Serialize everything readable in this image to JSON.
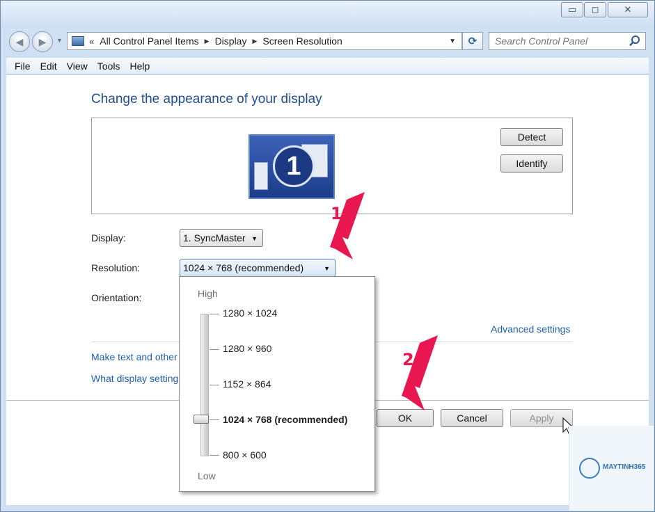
{
  "window": {
    "minimize_glyph": "▭",
    "maximize_glyph": "◻",
    "close_glyph": "✕"
  },
  "nav": {
    "crumb_overflow": "«",
    "breadcrumbs": [
      "All Control Panel Items",
      "Display",
      "Screen Resolution"
    ],
    "search_placeholder": "Search Control Panel"
  },
  "menu": [
    "File",
    "Edit",
    "View",
    "Tools",
    "Help"
  ],
  "main": {
    "title": "Change the appearance of your display",
    "monitor_number": "1",
    "detect_label": "Detect",
    "identify_label": "Identify",
    "display_label": "Display:",
    "display_value": "1. SyncMaster",
    "resolution_label": "Resolution:",
    "resolution_value": "1024 × 768 (recommended)",
    "orientation_label": "Orientation:",
    "advanced_link": "Advanced settings",
    "link_text_size": "Make text and other",
    "link_settings": "What display setting",
    "ok_label": "OK",
    "cancel_label": "Cancel",
    "apply_label": "Apply"
  },
  "resolution_popup": {
    "high_label": "High",
    "low_label": "Low",
    "options": [
      "1280 × 1024",
      "1280 × 960",
      "1152 × 864",
      "1024 × 768 (recommended)",
      "800 × 600"
    ],
    "selected_index": 3
  },
  "annotations": {
    "step1": "1",
    "step2": "2",
    "arrow_color": "#e8174f"
  },
  "watermark": {
    "brand": "MAYTINH365"
  },
  "icons": {
    "back": "back-arrow-icon",
    "forward": "forward-arrow-icon",
    "control_panel": "control-panel-icon",
    "refresh": "refresh-icon",
    "search": "search-icon",
    "cursor": "mouse-pointer-icon"
  }
}
